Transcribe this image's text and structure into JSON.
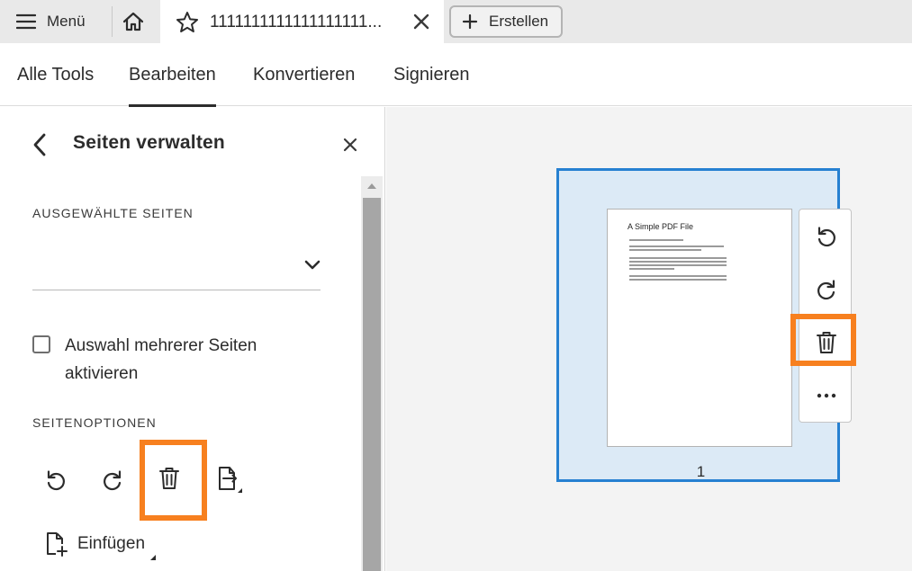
{
  "topbar": {
    "menu_label": "Menü",
    "doc_tab_title": "1111111111111111111...",
    "create_label": "Erstellen"
  },
  "nav": {
    "items": [
      {
        "label": "Alle Tools"
      },
      {
        "label": "Bearbeiten",
        "active": true
      },
      {
        "label": "Konvertieren"
      },
      {
        "label": "Signieren"
      }
    ]
  },
  "panel": {
    "title": "Seiten verwalten",
    "selected_pages_label": "AUSGEWÄHLTE SEITEN",
    "selected_pages_value": "",
    "multi_select_label": "Auswahl mehrerer Seiten aktivieren",
    "multi_select_checked": false,
    "page_options_label": "SEITENOPTIONEN",
    "insert_label": "Einfügen"
  },
  "canvas": {
    "page_number": "1",
    "pdf_preview_title": "A Simple PDF File"
  },
  "colors": {
    "accent_blue": "#2680d1",
    "page_frame_fill": "#dceaf6",
    "highlight_orange": "#f7801f"
  }
}
